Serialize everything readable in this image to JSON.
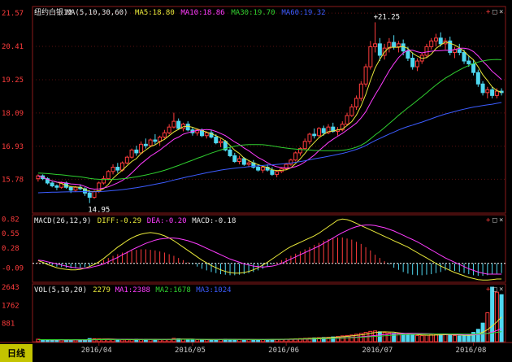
{
  "instrument": "纽约白银12",
  "colors": {
    "background": "#000000",
    "frame": "#8b1a1a",
    "up": "#ff3c3c",
    "down": "#4fd8f0",
    "ma5": "#e8e83a",
    "ma10": "#ff3cff",
    "ma30": "#30d030",
    "ma60": "#3c5cff",
    "dif": "#e8e83a",
    "dea": "#ff3cff",
    "macd_pos": "#ff3c3c",
    "macd_neg": "#4fd8f0",
    "axis_text": "#ff3c3c",
    "date_text": "#c8c8c8"
  },
  "main_panel": {
    "legend": [
      {
        "text": "纽约白银12",
        "color": "#e8e8e8"
      },
      {
        "text": "MA(5,10,30,60)",
        "color": "#e8e8e8"
      },
      {
        "text": "MA5:18.80",
        "color": "#e8e83a"
      },
      {
        "text": "MA10:18.86",
        "color": "#ff3cff"
      },
      {
        "text": "MA30:19.70",
        "color": "#30d030"
      },
      {
        "text": "MA60:19.32",
        "color": "#3c5cff"
      }
    ],
    "price_labels": [
      "21.57",
      "20.41",
      "19.25",
      "18.09",
      "16.93",
      "15.78"
    ]
  },
  "macd_panel": {
    "legend": [
      {
        "text": "MACD(26,12,9)",
        "color": "#e8e8e8"
      },
      {
        "text": "DIFF:-0.29",
        "color": "#e8e83a"
      },
      {
        "text": "DEA:-0.20",
        "color": "#ff3cff"
      },
      {
        "text": "MACD:-0.18",
        "color": "#e8e8e8"
      }
    ],
    "labels": [
      "0.82",
      "0.55",
      "0.28",
      "-0.09"
    ]
  },
  "vol_panel": {
    "legend": [
      {
        "text": "VOL(5,10,20)",
        "color": "#e8e8e8"
      },
      {
        "text": "2279",
        "color": "#e8e83a"
      },
      {
        "text": "MA1:2388",
        "color": "#ff3cff"
      },
      {
        "text": "MA2:1678",
        "color": "#30d030"
      },
      {
        "text": "MA3:1024",
        "color": "#3c5cff"
      }
    ],
    "labels": [
      "2643",
      "1762",
      "881"
    ]
  },
  "x_labels": [
    "2016/04",
    "2016/05",
    "2016/06",
    "2016/07",
    "2016/08"
  ],
  "period_tab": "日线",
  "panel_buttons": [
    "+",
    "□",
    "×"
  ],
  "chart_data": {
    "type": "candlestick",
    "series_name": "纽约白银12",
    "annotations": [
      {
        "label": "+21.25",
        "value": 21.25
      },
      {
        "label": "14.95",
        "value": 14.95
      }
    ],
    "ohlc": [
      [
        15.8,
        15.95,
        15.7,
        15.9
      ],
      [
        15.9,
        15.95,
        15.75,
        15.8
      ],
      [
        15.8,
        15.85,
        15.6,
        15.65
      ],
      [
        15.65,
        15.7,
        15.5,
        15.55
      ],
      [
        15.55,
        15.6,
        15.4,
        15.5
      ],
      [
        15.5,
        15.7,
        15.45,
        15.65
      ],
      [
        15.65,
        15.7,
        15.45,
        15.5
      ],
      [
        15.5,
        15.55,
        15.3,
        15.4
      ],
      [
        15.4,
        15.55,
        15.35,
        15.5
      ],
      [
        15.5,
        15.6,
        15.4,
        15.45
      ],
      [
        15.45,
        15.5,
        15.2,
        15.3
      ],
      [
        15.3,
        15.4,
        14.95,
        15.15
      ],
      [
        15.15,
        15.4,
        15.1,
        15.35
      ],
      [
        15.35,
        15.7,
        15.3,
        15.65
      ],
      [
        15.65,
        15.9,
        15.6,
        15.8
      ],
      [
        15.8,
        16.1,
        15.75,
        16.05
      ],
      [
        16.05,
        16.3,
        15.95,
        16.2
      ],
      [
        16.2,
        16.35,
        16.0,
        16.1
      ],
      [
        16.1,
        16.4,
        16.05,
        16.35
      ],
      [
        16.35,
        16.6,
        16.3,
        16.55
      ],
      [
        16.55,
        16.85,
        16.5,
        16.8
      ],
      [
        16.8,
        16.95,
        16.6,
        16.7
      ],
      [
        16.7,
        17.1,
        16.65,
        17.0
      ],
      [
        17.0,
        17.2,
        16.85,
        16.95
      ],
      [
        16.95,
        17.2,
        16.9,
        17.15
      ],
      [
        17.15,
        17.35,
        17.0,
        17.1
      ],
      [
        17.1,
        17.3,
        16.95,
        17.25
      ],
      [
        17.25,
        17.5,
        17.2,
        17.4
      ],
      [
        17.4,
        17.7,
        17.35,
        17.6
      ],
      [
        17.6,
        18.1,
        17.55,
        17.8
      ],
      [
        17.8,
        17.9,
        17.5,
        17.55
      ],
      [
        17.55,
        17.75,
        17.45,
        17.7
      ],
      [
        17.7,
        17.8,
        17.45,
        17.5
      ],
      [
        17.5,
        17.6,
        17.3,
        17.4
      ],
      [
        17.4,
        17.55,
        17.3,
        17.5
      ],
      [
        17.5,
        17.55,
        17.25,
        17.3
      ],
      [
        17.3,
        17.45,
        17.2,
        17.4
      ],
      [
        17.4,
        17.5,
        17.2,
        17.25
      ],
      [
        17.25,
        17.35,
        17.0,
        17.05
      ],
      [
        17.05,
        17.2,
        16.9,
        17.1
      ],
      [
        17.1,
        17.15,
        16.75,
        16.8
      ],
      [
        16.8,
        16.9,
        16.55,
        16.6
      ],
      [
        16.6,
        16.7,
        16.35,
        16.4
      ],
      [
        16.4,
        16.6,
        16.3,
        16.5
      ],
      [
        16.5,
        16.55,
        16.25,
        16.3
      ],
      [
        16.3,
        16.45,
        16.2,
        16.35
      ],
      [
        16.35,
        16.45,
        16.15,
        16.2
      ],
      [
        16.2,
        16.3,
        16.05,
        16.1
      ],
      [
        16.1,
        16.25,
        16.0,
        16.2
      ],
      [
        16.2,
        16.3,
        16.05,
        16.1
      ],
      [
        16.1,
        16.2,
        15.9,
        15.95
      ],
      [
        15.95,
        16.1,
        15.85,
        16.05
      ],
      [
        16.05,
        16.2,
        16.0,
        16.15
      ],
      [
        16.15,
        16.35,
        16.1,
        16.3
      ],
      [
        16.3,
        16.5,
        16.25,
        16.45
      ],
      [
        16.45,
        16.75,
        16.4,
        16.7
      ],
      [
        16.7,
        16.9,
        16.6,
        16.85
      ],
      [
        16.85,
        17.2,
        16.8,
        17.1
      ],
      [
        17.1,
        17.4,
        17.0,
        17.35
      ],
      [
        17.35,
        17.55,
        17.2,
        17.3
      ],
      [
        17.3,
        17.6,
        17.25,
        17.55
      ],
      [
        17.55,
        17.65,
        17.3,
        17.4
      ],
      [
        17.4,
        17.7,
        17.35,
        17.6
      ],
      [
        17.6,
        17.75,
        17.4,
        17.45
      ],
      [
        17.45,
        17.6,
        17.3,
        17.5
      ],
      [
        17.5,
        17.8,
        17.45,
        17.7
      ],
      [
        17.7,
        18.1,
        17.65,
        18.0
      ],
      [
        18.0,
        18.4,
        17.95,
        18.3
      ],
      [
        18.3,
        18.7,
        18.2,
        18.6
      ],
      [
        18.6,
        19.2,
        18.5,
        19.1
      ],
      [
        19.1,
        19.8,
        19.0,
        19.7
      ],
      [
        19.7,
        20.6,
        19.6,
        20.4
      ],
      [
        20.4,
        21.25,
        20.2,
        20.5
      ],
      [
        20.5,
        20.7,
        19.9,
        20.1
      ],
      [
        20.1,
        20.5,
        19.95,
        20.35
      ],
      [
        20.35,
        20.7,
        20.2,
        20.55
      ],
      [
        20.55,
        20.8,
        20.3,
        20.4
      ],
      [
        20.4,
        20.6,
        20.2,
        20.5
      ],
      [
        20.5,
        20.65,
        20.1,
        20.25
      ],
      [
        20.25,
        20.4,
        19.9,
        20.0
      ],
      [
        20.0,
        20.2,
        19.6,
        19.7
      ],
      [
        19.7,
        20.0,
        19.55,
        19.9
      ],
      [
        19.9,
        20.2,
        19.8,
        20.1
      ],
      [
        20.1,
        20.5,
        20.0,
        20.4
      ],
      [
        20.4,
        20.7,
        20.3,
        20.6
      ],
      [
        20.6,
        20.85,
        20.4,
        20.7
      ],
      [
        20.7,
        20.9,
        20.4,
        20.5
      ],
      [
        20.5,
        20.7,
        20.3,
        20.6
      ],
      [
        20.6,
        20.75,
        20.1,
        20.2
      ],
      [
        20.2,
        20.4,
        20.0,
        20.3
      ],
      [
        20.3,
        20.5,
        20.1,
        20.2
      ],
      [
        20.2,
        20.3,
        19.8,
        19.9
      ],
      [
        19.9,
        20.1,
        19.7,
        19.8
      ],
      [
        19.8,
        19.95,
        19.4,
        19.5
      ],
      [
        19.5,
        19.6,
        19.0,
        19.1
      ],
      [
        19.1,
        19.2,
        18.7,
        18.8
      ],
      [
        18.8,
        19.0,
        18.6,
        18.9
      ],
      [
        18.9,
        19.0,
        18.6,
        18.7
      ],
      [
        18.7,
        18.95,
        18.6,
        18.85
      ],
      [
        18.85,
        18.95,
        18.7,
        18.8
      ]
    ],
    "macd_hist": [
      0.02,
      0.0,
      -0.02,
      -0.04,
      -0.06,
      -0.07,
      -0.08,
      -0.09,
      -0.09,
      -0.08,
      -0.07,
      -0.05,
      -0.02,
      0.02,
      0.06,
      0.1,
      0.14,
      0.17,
      0.2,
      0.22,
      0.24,
      0.25,
      0.26,
      0.26,
      0.25,
      0.24,
      0.22,
      0.2,
      0.17,
      0.14,
      0.1,
      0.06,
      0.02,
      -0.02,
      -0.06,
      -0.1,
      -0.13,
      -0.16,
      -0.18,
      -0.2,
      -0.21,
      -0.22,
      -0.22,
      -0.21,
      -0.2,
      -0.18,
      -0.16,
      -0.13,
      -0.1,
      -0.06,
      -0.02,
      0.02,
      0.06,
      0.1,
      0.14,
      0.18,
      0.22,
      0.26,
      0.3,
      0.34,
      0.38,
      0.42,
      0.45,
      0.47,
      0.48,
      0.48,
      0.46,
      0.44,
      0.4,
      0.36,
      0.3,
      0.24,
      0.16,
      0.1,
      0.04,
      -0.02,
      -0.08,
      -0.12,
      -0.16,
      -0.19,
      -0.21,
      -0.22,
      -0.22,
      -0.21,
      -0.2,
      -0.18,
      -0.16,
      -0.13,
      -0.12,
      -0.14,
      -0.16,
      -0.18,
      -0.2,
      -0.22,
      -0.23,
      -0.23,
      -0.22,
      -0.2,
      -0.19,
      -0.18
    ],
    "dif": [
      0.05,
      0.02,
      -0.02,
      -0.05,
      -0.08,
      -0.1,
      -0.11,
      -0.12,
      -0.12,
      -0.11,
      -0.09,
      -0.06,
      -0.02,
      0.03,
      0.09,
      0.16,
      0.23,
      0.3,
      0.36,
      0.42,
      0.47,
      0.51,
      0.54,
      0.56,
      0.57,
      0.56,
      0.54,
      0.51,
      0.47,
      0.42,
      0.36,
      0.3,
      0.24,
      0.18,
      0.12,
      0.06,
      0.01,
      -0.04,
      -0.08,
      -0.12,
      -0.15,
      -0.17,
      -0.18,
      -0.18,
      -0.17,
      -0.15,
      -0.12,
      -0.08,
      -0.03,
      0.02,
      0.08,
      0.14,
      0.2,
      0.26,
      0.31,
      0.35,
      0.39,
      0.43,
      0.47,
      0.51,
      0.56,
      0.62,
      0.68,
      0.74,
      0.8,
      0.82,
      0.81,
      0.78,
      0.74,
      0.7,
      0.66,
      0.62,
      0.58,
      0.54,
      0.5,
      0.46,
      0.42,
      0.38,
      0.34,
      0.3,
      0.25,
      0.2,
      0.15,
      0.1,
      0.05,
      0.0,
      -0.05,
      -0.09,
      -0.13,
      -0.17,
      -0.2,
      -0.23,
      -0.26,
      -0.28,
      -0.3,
      -0.31,
      -0.31,
      -0.3,
      -0.29,
      -0.29
    ],
    "dea": [
      0.06,
      0.05,
      0.03,
      0.01,
      -0.01,
      -0.03,
      -0.05,
      -0.07,
      -0.08,
      -0.09,
      -0.09,
      -0.08,
      -0.06,
      -0.04,
      -0.01,
      0.03,
      0.07,
      0.11,
      0.16,
      0.2,
      0.25,
      0.29,
      0.33,
      0.37,
      0.4,
      0.43,
      0.45,
      0.46,
      0.47,
      0.47,
      0.46,
      0.44,
      0.42,
      0.39,
      0.36,
      0.32,
      0.28,
      0.24,
      0.2,
      0.16,
      0.12,
      0.08,
      0.05,
      0.02,
      -0.01,
      -0.03,
      -0.05,
      -0.06,
      -0.07,
      -0.06,
      -0.05,
      -0.03,
      0.0,
      0.04,
      0.08,
      0.12,
      0.16,
      0.2,
      0.24,
      0.28,
      0.32,
      0.37,
      0.42,
      0.47,
      0.52,
      0.57,
      0.61,
      0.65,
      0.68,
      0.7,
      0.71,
      0.71,
      0.7,
      0.68,
      0.66,
      0.63,
      0.6,
      0.56,
      0.52,
      0.48,
      0.44,
      0.4,
      0.35,
      0.3,
      0.25,
      0.2,
      0.15,
      0.1,
      0.06,
      0.02,
      -0.02,
      -0.06,
      -0.1,
      -0.13,
      -0.16,
      -0.18,
      -0.2,
      -0.2,
      -0.2,
      -0.2
    ],
    "volume": [
      120,
      100,
      90,
      80,
      85,
      95,
      90,
      80,
      85,
      90,
      95,
      150,
      140,
      130,
      120,
      110,
      100,
      95,
      90,
      100,
      110,
      120,
      115,
      110,
      105,
      100,
      95,
      100,
      110,
      160,
      140,
      120,
      110,
      100,
      95,
      90,
      95,
      100,
      105,
      110,
      120,
      115,
      110,
      105,
      100,
      95,
      90,
      95,
      100,
      105,
      110,
      115,
      120,
      125,
      130,
      140,
      150,
      160,
      170,
      180,
      190,
      200,
      210,
      230,
      250,
      280,
      300,
      320,
      360,
      400,
      450,
      500,
      520,
      480,
      440,
      420,
      400,
      380,
      360,
      340,
      320,
      300,
      290,
      310,
      330,
      350,
      360,
      340,
      320,
      300,
      280,
      300,
      350,
      450,
      600,
      900,
      1400,
      2643,
      2400,
      2279
    ],
    "vol_ma": [
      {
        "values": [
          100,
          98,
          95,
          92,
          90,
          90,
          88,
          87,
          88,
          89,
          91,
          100,
          108,
          115,
          124,
          130,
          124,
          119,
          111,
          103,
          99,
          98,
          100,
          105,
          110,
          113,
          111,
          109,
          110,
          119,
          127,
          129,
          128,
          126,
          114,
          105,
          100,
          98,
          99,
          103,
          108,
          110,
          112,
          112,
          110,
          107,
          103,
          100,
          99,
          100,
          104,
          108,
          112,
          117,
          122,
          128,
          135,
          144,
          154,
          164,
          174,
          184,
          195,
          206,
          220,
          238,
          258,
          280,
          305,
          332,
          364,
          401,
          440,
          471,
          477,
          470,
          461,
          431,
          403,
          380,
          359,
          340,
          324,
          317,
          314,
          321,
          333,
          338,
          339,
          337,
          326,
          312,
          309,
          327,
          375,
          459,
          580,
          760,
          960,
          1200
        ],
        "name": "MA1"
      },
      {
        "values": [
          100,
          99,
          97,
          95,
          93,
          92,
          91,
          90,
          89,
          89,
          89,
          92,
          96,
          100,
          104,
          109,
          112,
          115,
          117,
          117,
          116,
          114,
          112,
          110,
          108,
          107,
          107,
          107,
          109,
          112,
          115,
          118,
          118,
          118,
          117,
          114,
          112,
          109,
          107,
          106,
          106,
          107,
          108,
          108,
          108,
          107,
          106,
          106,
          106,
          106,
          106,
          107,
          108,
          109,
          111,
          114,
          119,
          124,
          129,
          134,
          140,
          147,
          155,
          163,
          172,
          183,
          195,
          208,
          222,
          238,
          256,
          277,
          299,
          322,
          343,
          364,
          380,
          391,
          399,
          402,
          402,
          400,
          395,
          389,
          381,
          375,
          370,
          364,
          359,
          353,
          347,
          341,
          338,
          338,
          350,
          370,
          405,
          460,
          540,
          640
        ],
        "name": "MA2"
      },
      {
        "values": [
          100,
          100,
          99,
          98,
          97,
          96,
          95,
          94,
          93,
          93,
          93,
          94,
          95,
          97,
          99,
          101,
          103,
          105,
          107,
          109,
          110,
          111,
          111,
          111,
          111,
          111,
          111,
          112,
          112,
          113,
          114,
          115,
          116,
          116,
          116,
          115,
          114,
          113,
          112,
          111,
          110,
          110,
          110,
          110,
          110,
          110,
          110,
          110,
          111,
          112,
          113,
          114,
          115,
          117,
          119,
          121,
          124,
          127,
          131,
          135,
          139,
          144,
          150,
          156,
          163,
          171,
          180,
          190,
          201,
          213,
          226,
          240,
          255,
          270,
          285,
          300,
          315,
          328,
          340,
          350,
          358,
          364,
          369,
          372,
          374,
          376,
          377,
          377,
          376,
          375,
          374,
          372,
          371,
          372,
          376,
          384,
          398,
          420,
          450,
          490
        ],
        "name": "MA3"
      }
    ]
  }
}
